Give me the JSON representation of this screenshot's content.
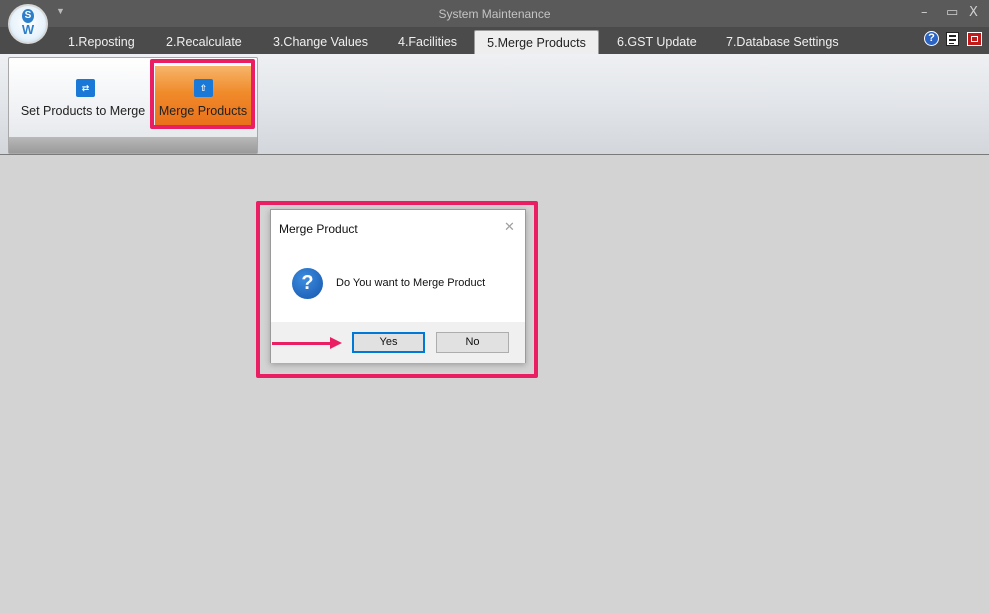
{
  "window": {
    "title": "System Maintenance",
    "controls": {
      "minimize": "–",
      "maximize": "▭",
      "close": "X"
    }
  },
  "logo": {
    "letter_top": "S",
    "letter_bottom": "W"
  },
  "tabs": [
    {
      "label": "1.Reposting"
    },
    {
      "label": "2.Recalculate"
    },
    {
      "label": "3.Change Values"
    },
    {
      "label": "4.Facilities"
    },
    {
      "label": "5.Merge Products",
      "active": true
    },
    {
      "label": "6.GST Update"
    },
    {
      "label": "7.Database Settings"
    }
  ],
  "topbar_icons": [
    "help-icon",
    "document-icon",
    "pdf-icon"
  ],
  "ribbon": {
    "buttons": [
      {
        "label": "Set Products to Merge",
        "icon": "set-products-icon"
      },
      {
        "label": "Merge Products",
        "icon": "merge-products-icon",
        "highlighted": true
      }
    ]
  },
  "dialog": {
    "title": "Merge Product",
    "close_glyph": "✕",
    "icon": "question-icon",
    "message": "Do You want to Merge Product",
    "buttons": {
      "yes": "Yes",
      "no": "No"
    }
  },
  "colors": {
    "highlight": "#ea1f63",
    "accent_orange": "#f08a2a",
    "titlebar": "#5a5a5a",
    "tabstrip": "#4b4b4b",
    "workspace": "#d3d3d3"
  }
}
